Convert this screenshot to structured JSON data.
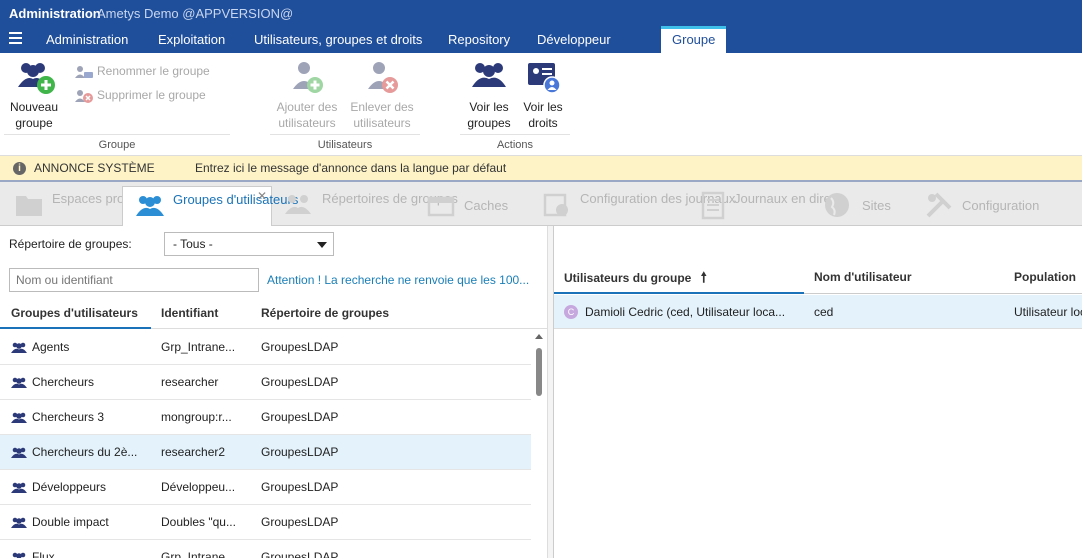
{
  "title": {
    "app": "Administration",
    "sub": "Ametys Demo @APPVERSION@"
  },
  "menu_tabs": [
    "Administration",
    "Exploitation",
    "Utilisateurs, groupes et droits",
    "Repository",
    "Développeur",
    "Groupe"
  ],
  "ribbon": {
    "new_group": "Nouveau groupe",
    "rename_group": "Renommer le groupe",
    "delete_group": "Supprimer le groupe",
    "group_label": "Groupe",
    "add_users": "Ajouter des utilisateurs",
    "remove_users": "Enlever des utilisateurs",
    "users_label": "Utilisateurs",
    "view_groups": "Voir les groupes",
    "view_rights": "Voir les droits",
    "actions_label": "Actions"
  },
  "announce": {
    "label": "ANNONCE SYSTÈME",
    "message": "Entrez ici le message d'annonce dans la langue par défaut"
  },
  "tool_tabs": {
    "spaces": "Espaces projets",
    "groups": "Groupes d'utilisateurs",
    "group_dirs": "Répertoires de groupes",
    "caches": "Caches",
    "log_config": "Configuration des journaux",
    "live_logs": "Journaux en direct",
    "sites": "Sites",
    "config": "Configuration"
  },
  "left": {
    "dir_label": "Répertoire de groupes:",
    "dir_value": "- Tous -",
    "search_placeholder": "Nom ou identifiant",
    "warning": "Attention ! La recherche ne renvoie que les 100...",
    "columns": [
      "Groupes d'utilisateurs",
      "Identifiant",
      "Répertoire de groupes"
    ],
    "rows": [
      {
        "name": "Agents",
        "id": "Grp_Intrane...",
        "dir": "GroupesLDAP"
      },
      {
        "name": "Chercheurs",
        "id": "researcher",
        "dir": "GroupesLDAP"
      },
      {
        "name": "Chercheurs 3",
        "id": "mongroup:r...",
        "dir": "GroupesLDAP"
      },
      {
        "name": "Chercheurs du 2è...",
        "id": "researcher2",
        "dir": "GroupesLDAP"
      },
      {
        "name": "Développeurs",
        "id": "Développeu...",
        "dir": "GroupesLDAP"
      },
      {
        "name": "Double impact",
        "id": "Doubles \"qu...",
        "dir": "GroupesLDAP"
      },
      {
        "name": "Flux",
        "id": "Grp_Intrane...",
        "dir": "GroupesLDAP"
      }
    ]
  },
  "right": {
    "columns": [
      "Utilisateurs du groupe",
      "Nom d'utilisateur",
      "Population"
    ],
    "rows": [
      {
        "avatar": "C",
        "name": "Damioli Cedric (ced, Utilisateur loca...",
        "login": "ced",
        "population": "Utilisateur local"
      }
    ]
  },
  "colors": {
    "header": "#1f4e9a",
    "accent": "#1a73b8",
    "announce_bg": "#fdf3c7",
    "selected_row": "#e3f2fb"
  }
}
